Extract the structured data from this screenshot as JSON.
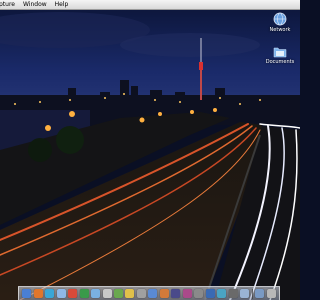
{
  "menubar": {
    "items": [
      "pture",
      "Window",
      "Help"
    ]
  },
  "desktop": {
    "wallpaper": "night-city-highway-long-exposure",
    "icons": [
      {
        "label": "Network",
        "icon": "network-globe-icon"
      },
      {
        "label": "Documents",
        "icon": "documents-folder-icon"
      }
    ]
  },
  "dock": {
    "items": [
      {
        "name": "finder-icon",
        "color": "#4a7fd4"
      },
      {
        "name": "firefox-icon",
        "color": "#e0762b"
      },
      {
        "name": "app-icon",
        "color": "#3aa6d6"
      },
      {
        "name": "itunes-icon",
        "color": "#8fb8e8"
      },
      {
        "name": "app-icon",
        "color": "#d94a3a"
      },
      {
        "name": "app-icon",
        "color": "#3a9a4a"
      },
      {
        "name": "app-icon",
        "color": "#7ab0e0"
      },
      {
        "name": "app-icon",
        "color": "#c8c8c8"
      },
      {
        "name": "app-icon",
        "color": "#6aa84f"
      },
      {
        "name": "app-icon",
        "color": "#e0c04a"
      },
      {
        "name": "app-icon",
        "color": "#a0a0a0"
      },
      {
        "name": "app-icon",
        "color": "#5a8ad4"
      },
      {
        "name": "app-icon",
        "color": "#d47a3a"
      },
      {
        "name": "app-icon",
        "color": "#4a4a8a"
      },
      {
        "name": "app-icon",
        "color": "#aa4a8a"
      },
      {
        "name": "app-icon",
        "color": "#8a8a8a"
      },
      {
        "name": "app-icon",
        "color": "#3a6ab4"
      },
      {
        "name": "app-icon",
        "color": "#4aa4c4"
      },
      {
        "name": "app-icon",
        "color": "#6a6a6a"
      },
      {
        "name": "app-icon",
        "color": "#9ab4d4"
      },
      {
        "name": "downloads-icon",
        "color": "#7a9ac4"
      },
      {
        "name": "trash-icon",
        "color": "#b8b8b8"
      }
    ]
  }
}
